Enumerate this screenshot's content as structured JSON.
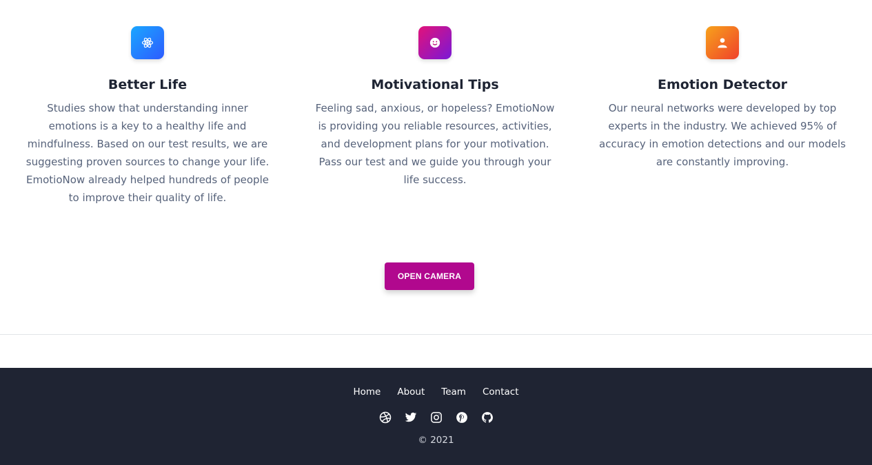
{
  "features": [
    {
      "icon": "atom-icon",
      "title": "Better Life",
      "text": "Studies show that understanding inner emotions is a key to a healthy life and mindfulness. Based on our test results, we are suggesting proven sources to change your life. EmotioNow already helped hundreds of people to improve their quality of life."
    },
    {
      "icon": "smile-icon",
      "title": "Motivational Tips",
      "text": "Feeling sad, anxious, or hopeless? EmotioNow is providing you reliable resources, activities, and development plans for your motivation. Pass our test and we guide you through your life success."
    },
    {
      "icon": "user-icon",
      "title": "Emotion Detector",
      "text": "Our neural networks were developed by top experts in the industry. We achieved 95% of accuracy in emotion detections and our models are constantly improving."
    }
  ],
  "cta": {
    "label": "OPEN CAMERA",
    "color": "#b1088e"
  },
  "footer": {
    "background": "#1f2433",
    "nav": [
      "Home",
      "About",
      "Team",
      "Contact"
    ],
    "social_icons": [
      "dribbble-icon",
      "twitter-icon",
      "instagram-icon",
      "pinterest-icon",
      "github-icon"
    ],
    "copyright": "© 2021"
  }
}
